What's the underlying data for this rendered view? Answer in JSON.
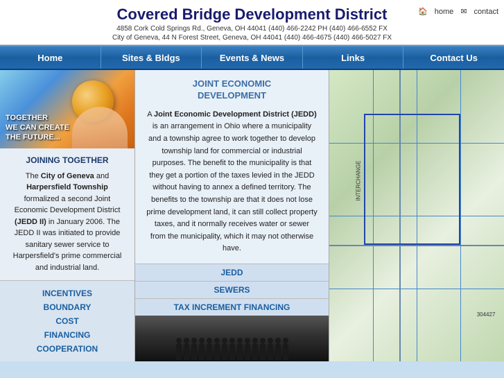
{
  "header": {
    "title": "Covered Bridge Development District",
    "address1": "4858 Cork Cold Springs Rd., Geneva, OH 44041 (440) 466-2242 PH (440) 466-6552 FX",
    "address2": "City of Geneva, 44 N Forest Street, Geneva, OH 44041 (440) 466-4675 (440) 466-5027 FX",
    "home_link": "home",
    "contact_link": "contact"
  },
  "nav": {
    "items": [
      {
        "label": "Home",
        "id": "home"
      },
      {
        "label": "Sites & Bldgs",
        "id": "sites"
      },
      {
        "label": "Events & News",
        "id": "events"
      },
      {
        "label": "Links",
        "id": "links"
      },
      {
        "label": "Contact Us",
        "id": "contact"
      }
    ]
  },
  "left_panel": {
    "hero_text": "TOGETHER\nWE CAN CREATE\nTHE FUTURE...",
    "section_title": "JOINING TOGETHER",
    "section_text": "The City of Geneva and Harpersfield Township formalized a second Joint Economic Development District (JEDD II) in January 2006. The JEDD II was initiated to provide sanitary sewer service to Harpersfield's prime commercial and industrial land.",
    "links": [
      {
        "label": "INCENTIVES",
        "id": "incentives"
      },
      {
        "label": "BOUNDARY",
        "id": "boundary"
      },
      {
        "label": "COST",
        "id": "cost"
      },
      {
        "label": "FINANCING",
        "id": "financing"
      },
      {
        "label": "COOPERATION",
        "id": "cooperation"
      }
    ]
  },
  "center_panel": {
    "title": "JOINT ECONOMIC\nDEVELOPMENT",
    "text": "A Joint Economic Development District (JEDD) is an arrangement in Ohio where a municipality and a township agree to work together to develop township land for commercial or industrial purposes. The benefit to the municipality is that they get a portion of the taxes levied in the JEDD without having to annex a defined territory. The benefits to the township are that it does not lose prime development land, it can still collect property taxes, and it normally receives water or sewer from the municipality, which it may not otherwise have.",
    "links": [
      {
        "label": "JEDD",
        "id": "jedd"
      },
      {
        "label": "SEWERS",
        "id": "sewers"
      },
      {
        "label": "TAX INCREMENT FINANCING",
        "id": "tif"
      }
    ]
  },
  "icons": {
    "home": "🏠",
    "contact": "✉"
  },
  "colors": {
    "nav_bg": "#2268ae",
    "header_title": "#1a1a6e",
    "link_color": "#1a5fa0",
    "jedd_title": "#3a6ea8"
  }
}
